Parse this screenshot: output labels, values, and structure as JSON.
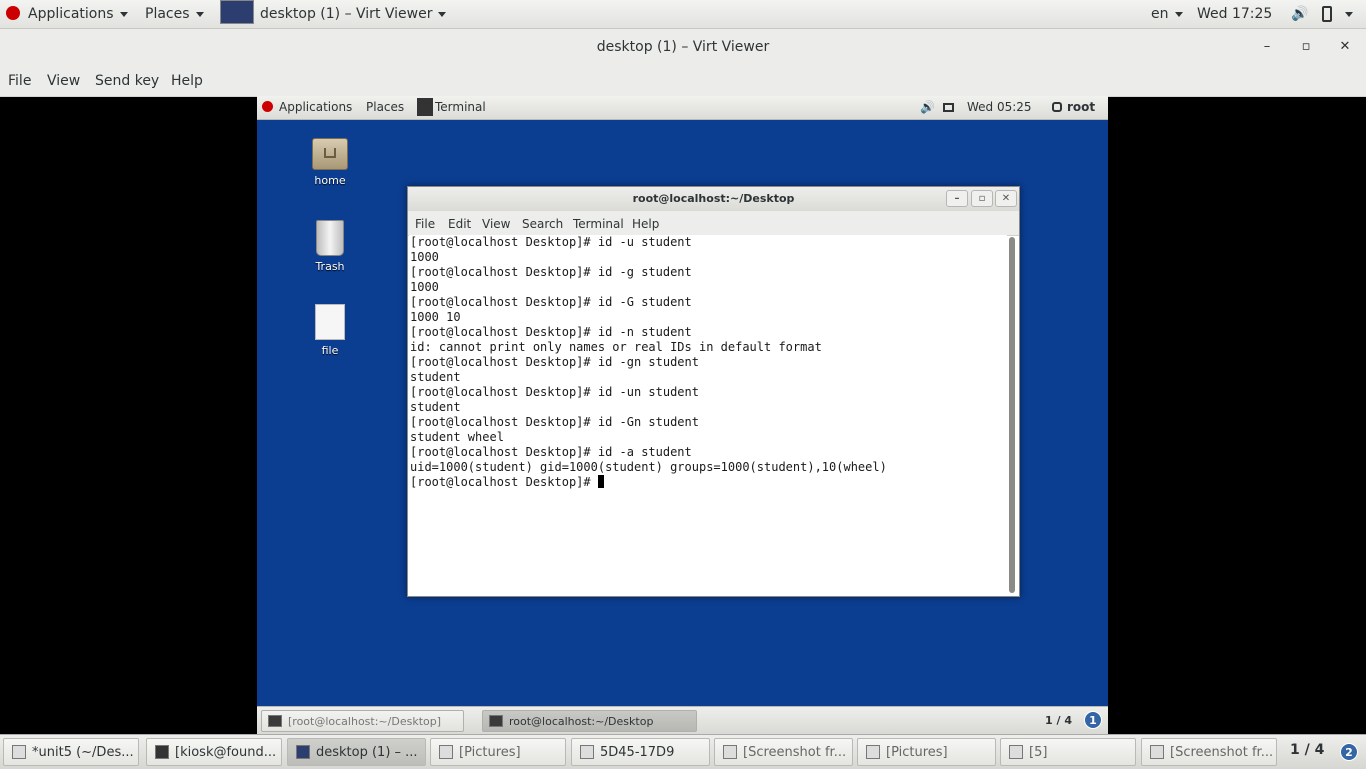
{
  "host_panel": {
    "applications": "Applications",
    "places": "Places",
    "active_app": "desktop (1) – Virt Viewer",
    "language": "en",
    "clock": "Wed 17:25"
  },
  "window": {
    "title": "desktop (1) – Virt Viewer",
    "minimize": "–",
    "maximize": "▫",
    "close": "✕"
  },
  "menubar": [
    "File",
    "View",
    "Send key",
    "Help"
  ],
  "guest": {
    "panel": {
      "applications": "Applications",
      "places": "Places",
      "active_app": "Terminal",
      "clock": "Wed 05:25",
      "user": "root"
    },
    "desktop_icons": [
      {
        "label": "home",
        "icon": "home-folder-icon"
      },
      {
        "label": "Trash",
        "icon": "trash-icon"
      },
      {
        "label": "file",
        "icon": "file-icon"
      }
    ],
    "terminal": {
      "title": "root@localhost:~/Desktop",
      "menu": [
        "File",
        "Edit",
        "View",
        "Search",
        "Terminal",
        "Help"
      ],
      "lines": [
        "[root@localhost Desktop]# id -u student",
        "1000",
        "[root@localhost Desktop]# id -g student",
        "1000",
        "[root@localhost Desktop]# id -G student",
        "1000 10",
        "[root@localhost Desktop]# id -n student",
        "id: cannot print only names or real IDs in default format",
        "[root@localhost Desktop]# id -gn student",
        "student",
        "[root@localhost Desktop]# id -un student",
        "student",
        "[root@localhost Desktop]# id -Gn student",
        "student wheel",
        "[root@localhost Desktop]# id -a student",
        "uid=1000(student) gid=1000(student) groups=1000(student),10(wheel)"
      ],
      "prompt": "[root@localhost Desktop]# "
    },
    "bottom_panel": {
      "tasks": [
        "[root@localhost:~/Desktop]",
        "root@localhost:~/Desktop"
      ],
      "workspace": "1 / 4",
      "notifications": "1"
    }
  },
  "taskbar": {
    "tasks": [
      "*unit5 (~/Des...",
      "[kiosk@found...",
      "desktop (1) – ...",
      "[Pictures]",
      "5D45-17D9",
      "[Screenshot fr...",
      "[Pictures]",
      "[5]",
      "[Screenshot fr..."
    ],
    "workspace": "1 / 4",
    "notifications": "2"
  },
  "colors": {
    "guest_desktop": "#0b3d91",
    "badge": "#3465a4"
  }
}
